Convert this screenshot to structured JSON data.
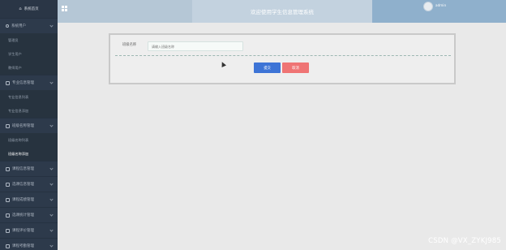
{
  "sidebar": {
    "home_label": "系统首页",
    "menus": [
      {
        "label": "系统用户",
        "icon": "user-icon",
        "items": [
          "管理员",
          "学生用户",
          "教师用户"
        ]
      },
      {
        "label": "专业信息管理",
        "icon": "doc-icon",
        "items": [
          "专业信息列表",
          "专业信息添加"
        ]
      },
      {
        "label": "班级名称管理",
        "icon": "doc-icon",
        "items": [
          "班级名称列表",
          "班级名称添加"
        ],
        "active_index": 1
      },
      {
        "label": "课程信息管理",
        "icon": "doc-icon",
        "items": []
      },
      {
        "label": "选课信息管理",
        "icon": "doc-icon",
        "items": []
      },
      {
        "label": "课程成绩管理",
        "icon": "doc-icon",
        "items": []
      },
      {
        "label": "选课统计管理",
        "icon": "doc-icon",
        "items": []
      },
      {
        "label": "课程评价管理",
        "icon": "doc-icon",
        "items": []
      },
      {
        "label": "课程考勤管理",
        "icon": "doc-icon",
        "items": []
      }
    ]
  },
  "header": {
    "title": "欢迎使用学生信息管理系统",
    "username": "admin"
  },
  "form": {
    "field_label": "班级名称",
    "field_placeholder": "请输入班级名称",
    "submit_label": "提交",
    "cancel_label": "取消"
  },
  "watermark": "CSDN @VX_ZYKJ985",
  "colors": {
    "sidebar_bg": "#2d3a4b",
    "topbar_bg": "#b5c7d6",
    "submit": "#3d74d6",
    "cancel": "#ef7474"
  }
}
